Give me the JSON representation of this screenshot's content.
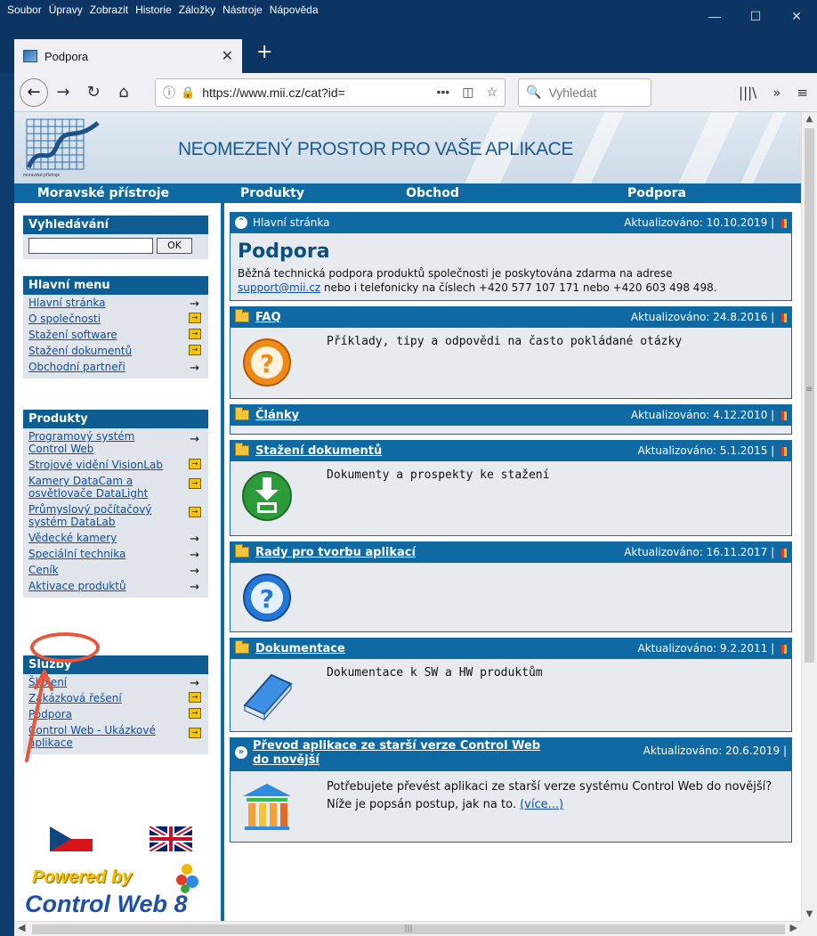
{
  "browser": {
    "menu": [
      "Soubor",
      "Úpravy",
      "Zobrazit",
      "Historie",
      "Záložky",
      "Nástroje",
      "Nápověda"
    ],
    "tab_title": "Podpora",
    "url": "https://www.mii.cz/cat?id=",
    "search_placeholder": "Vyhledat"
  },
  "site": {
    "logo_text": "moravské přístroje",
    "tagline": "NEOMEZENÝ PROSTOR PRO VAŠE APLIKACE",
    "topnav": [
      "Moravské přístroje",
      "Produkty",
      "Obchod",
      "Podpora"
    ]
  },
  "sidebar": {
    "search": {
      "title": "Vyhledávání",
      "button": "OK"
    },
    "main_menu": {
      "title": "Hlavní menu",
      "items": [
        "Hlavní stránka",
        "O společnosti",
        "Stažení software",
        "Stažení dokumentů",
        "Obchodní partneři"
      ]
    },
    "products": {
      "title": "Produkty",
      "items": [
        "Programový systém Control Web",
        "Strojové vidění VisionLab",
        "Kamery DataCam a osvětlovače DataLight",
        "Průmyslový počítačový systém DataLab",
        "Vědecké kamery",
        "Speciální technika",
        "Ceník",
        "Aktivace produktů"
      ]
    },
    "services": {
      "title": "Služby",
      "items": [
        "Školení",
        "Zakázková řešení",
        "Podpora",
        "Control Web - Ukázkové aplikace"
      ]
    },
    "powered_by": "Powered by",
    "powered_product": "Control Web 8"
  },
  "content": {
    "header": {
      "label": "Hlavní stránka",
      "updated": "Aktualizováno: 10.10.2019"
    },
    "title": "Podpora",
    "intro": "Běžná technická podpora produktů společnosti je poskytována zdarma na adrese",
    "intro_link": "support@mii.cz",
    "intro_rest": " nebo i telefonicky na číslech +420 577 107 171 nebo +420 603 498 498.",
    "sections": [
      {
        "title": "FAQ",
        "updated": "Aktualizováno: 24.8.2016",
        "desc": "Příklady, tipy a odpovědi na často pokládané otázky"
      },
      {
        "title": "Články",
        "updated": "Aktualizováno: 4.12.2010",
        "desc": ""
      },
      {
        "title": "Stažení dokumentů",
        "updated": "Aktualizováno: 5.1.2015",
        "desc": "Dokumenty a prospekty ke stažení"
      },
      {
        "title": "Rady pro tvorbu aplikací",
        "updated": "Aktualizováno: 16.11.2017",
        "desc": ""
      },
      {
        "title": "Dokumentace",
        "updated": "Aktualizováno: 9.2.2011",
        "desc": "Dokumentace k SW a HW produktům"
      }
    ],
    "convert": {
      "title_line1": "Převod aplikace ze starší verze Control Web",
      "title_line2": "do novější",
      "updated": "Aktualizováno: 20.6.2019 |",
      "desc": "Potřebujete převést aplikaci ze starší verze systému Control Web do novější? Níže je popsán postup, jak na to.",
      "more": "(více...)"
    }
  },
  "colors": {
    "accent": "#0f6aa3",
    "annotation": "#e8553a",
    "link": "#0d4fa0"
  }
}
